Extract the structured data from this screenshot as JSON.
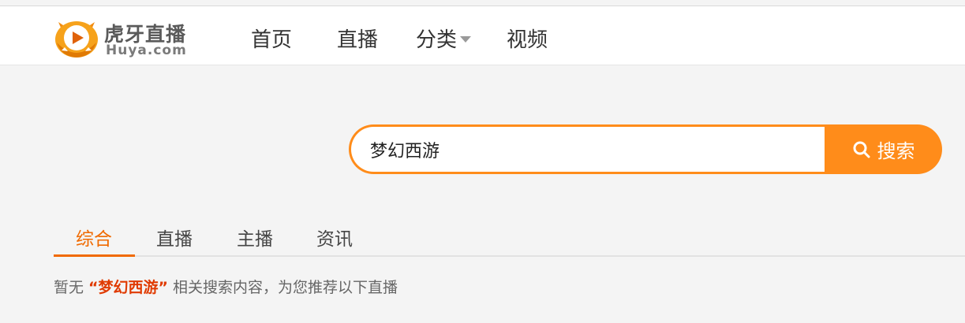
{
  "brand": {
    "name": "虎牙直播",
    "domain": "Huya.com",
    "accent": "#ff8c1a"
  },
  "nav": {
    "items": [
      {
        "label": "首页"
      },
      {
        "label": "直播"
      },
      {
        "label": "分类",
        "has_dropdown": true
      },
      {
        "label": "视频"
      }
    ]
  },
  "search": {
    "value": "梦幻西游",
    "button_label": "搜索",
    "icon": "search-icon"
  },
  "tabs": {
    "items": [
      {
        "label": "综合",
        "active": true
      },
      {
        "label": "直播"
      },
      {
        "label": "主播"
      },
      {
        "label": "资讯"
      }
    ],
    "active_color": "#f06a00"
  },
  "result_message": {
    "prefix": "暂无",
    "keyword": "“梦幻西游”",
    "suffix": "相关搜索内容，为您推荐以下直播"
  }
}
